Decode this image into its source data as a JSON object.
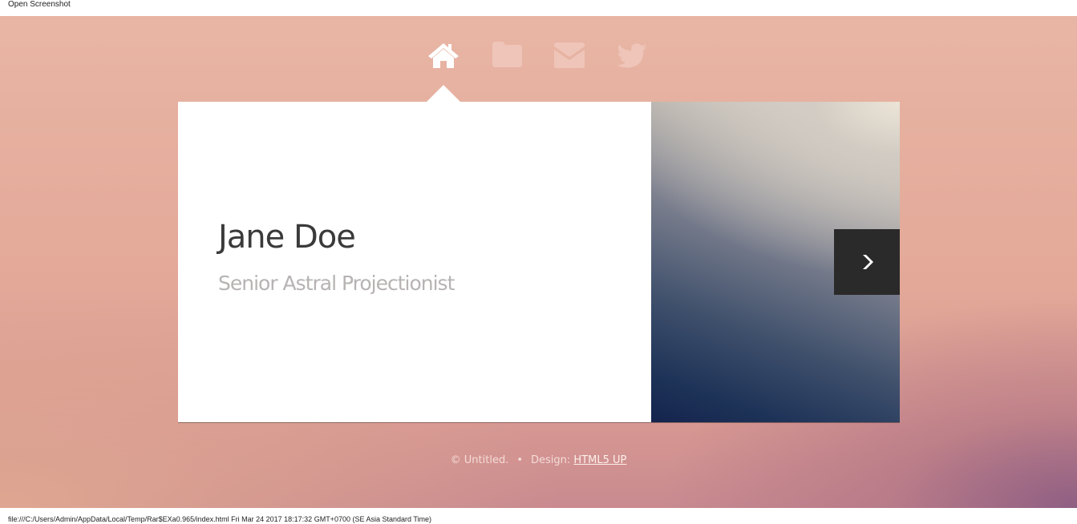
{
  "top_bar": {
    "label": "Open Screenshot"
  },
  "nav": {
    "items": [
      {
        "icon": "home-icon",
        "active": true
      },
      {
        "icon": "folder-icon",
        "active": false
      },
      {
        "icon": "envelope-icon",
        "active": false
      },
      {
        "icon": "twitter-icon",
        "active": false
      }
    ]
  },
  "card": {
    "name": "Jane Doe",
    "title": "Senior Astral Projectionist"
  },
  "footer": {
    "copyright": "© Untitled.",
    "separator": "•",
    "design_prefix": "Design:",
    "design_link": "HTML5 UP"
  },
  "bottom_bar": {
    "status": "file:///C:/Users/Admin/AppData/Local/Temp/Rar$EXa0.965/index.html Fri Mar 24 2017 18:17:32 GMT+0700 (SE Asia Standard Time)"
  },
  "colors": {
    "active_icon": "#ffffff",
    "inactive_icon": "#f0c7bb",
    "card_bg": "#ffffff",
    "name_text": "#3a3a3a",
    "subtitle_text": "#b7b3b3",
    "next_button_bg": "#2b2a2a"
  }
}
